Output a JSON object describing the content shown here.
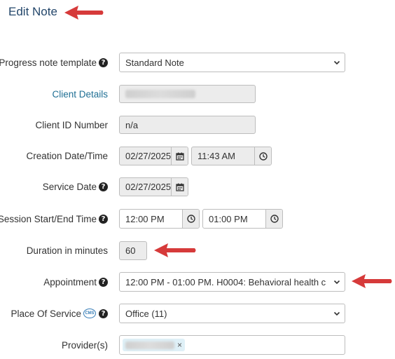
{
  "page": {
    "title": "Edit Note"
  },
  "form": {
    "template_label": "Progress note template",
    "template_value": "Standard Note",
    "client_details_label": "Client Details",
    "client_id_label": "Client ID Number",
    "client_id_value": "n/a",
    "creation_label": "Creation Date/Time",
    "creation_date": "02/27/2025",
    "creation_time": "11:43 AM",
    "service_date_label": "Service Date",
    "service_date": "02/27/2025",
    "session_label": "Session Start/End Time",
    "session_start": "12:00 PM",
    "session_end": "01:00 PM",
    "duration_label": "Duration in minutes",
    "duration_value": "60",
    "appointment_label": "Appointment",
    "appointment_value": "12:00 PM - 01:00 PM. H0004: Behavioral health c",
    "place_label": "Place Of Service",
    "place_badge": "CMS",
    "place_value": "Office (11)",
    "providers_label": "Provider(s)",
    "provider_remove": "×"
  },
  "icons": {
    "help": "question-circle-icon",
    "calendar": "calendar-icon",
    "clock": "clock-icon",
    "chevron": "chevron-down-icon",
    "annotation": "red-arrow-icon"
  },
  "colors": {
    "title": "#24476b",
    "link": "#1f6f94",
    "readonly_bg": "#ececec",
    "arrow": "#d63a3a",
    "tag_bg": "#dff0f7"
  }
}
